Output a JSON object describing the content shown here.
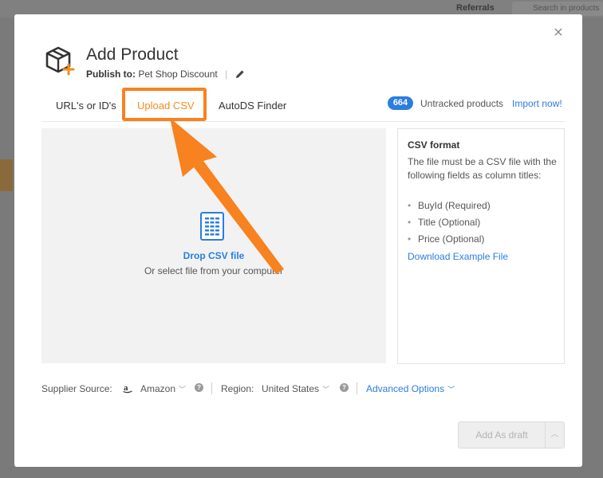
{
  "background": {
    "referrals_label": "Referrals",
    "search_placeholder": "Search in products"
  },
  "header": {
    "title": "Add Product",
    "publish_label": "Publish to:",
    "publish_store": "Pet Shop Discount"
  },
  "tabs": [
    {
      "label": "URL's or ID's",
      "active": false
    },
    {
      "label": "Upload CSV",
      "active": true
    },
    {
      "label": "AutoDS Finder",
      "active": false
    }
  ],
  "untracked": {
    "count": "664",
    "label": "Untracked products",
    "action": "Import now!"
  },
  "dropzone": {
    "title": "Drop CSV file",
    "subtitle": "Or select file from your computer"
  },
  "csv_info": {
    "title": "CSV format",
    "description": "The file must be a CSV file with the following fields as column titles:",
    "fields": [
      "BuyId (Required)",
      "Title (Optional)",
      "Price (Optional)"
    ],
    "download_link": "Download Example File"
  },
  "options": {
    "supplier_label": "Supplier Source:",
    "supplier_value": "Amazon",
    "region_label": "Region:",
    "region_value": "United States",
    "advanced": "Advanced Options"
  },
  "footer": {
    "add_draft": "Add As draft"
  },
  "colors": {
    "accent_orange": "#f7821f",
    "link_blue": "#2a7de1"
  },
  "icons": [
    "close-icon",
    "package-add-icon",
    "pencil-icon",
    "csv-file-icon",
    "amazon-icon",
    "help-icon",
    "chevron-down-icon",
    "chevron-up-icon"
  ]
}
